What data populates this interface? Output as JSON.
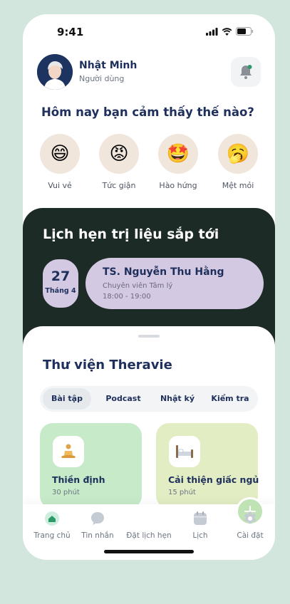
{
  "status_bar": {
    "time": "9:41"
  },
  "header": {
    "name": "Nhật Minh",
    "role": "Người dùng"
  },
  "mood": {
    "title": "Hôm nay bạn cảm thấy thế nào?",
    "options": [
      {
        "label": "Vui vẻ",
        "emoji": "😄"
      },
      {
        "label": "Tức giận",
        "emoji": "😡"
      },
      {
        "label": "Hào hứng",
        "emoji": "🤩"
      },
      {
        "label": "Mệt mỏi",
        "emoji": "🥱"
      }
    ]
  },
  "appointment": {
    "title": "Lịch hẹn trị liệu sắp tới",
    "day": "27",
    "month": "Tháng 4",
    "doctor": "TS. Nguyễn Thu Hằng",
    "role": "Chuyên viên Tâm lý",
    "time": "18:00 - 19:00"
  },
  "library": {
    "title": "Thư viện Theravie",
    "tabs": [
      "Bài tập",
      "Podcast",
      "Nhật ký",
      "Kiểm tra"
    ],
    "active_tab": "Bài tập",
    "cards": [
      {
        "title": "Thiền định",
        "duration": "30 phút",
        "icon": "meditation-icon",
        "color": "#c7ebc9"
      },
      {
        "title": "Cải thiện giấc ngủ",
        "duration": "15 phút",
        "icon": "bed-icon",
        "color": "#e3edc4"
      }
    ]
  },
  "nav": {
    "items": [
      {
        "label": "Trang chủ",
        "icon": "home-icon"
      },
      {
        "label": "Tin nhắn",
        "icon": "chat-icon"
      },
      {
        "label": "Đặt lịch hẹn",
        "icon": "plus-icon"
      },
      {
        "label": "Lịch",
        "icon": "calendar-icon"
      },
      {
        "label": "Cài đặt",
        "icon": "gear-icon"
      }
    ],
    "active": "Trang chủ"
  },
  "colors": {
    "background": "#d3e6dd",
    "navy": "#1e2f5c",
    "dark_panel": "#1d2b26",
    "lavender": "#d4c9e2",
    "mood_bg": "#f0e6dc",
    "accent_green": "#2f9a69"
  }
}
